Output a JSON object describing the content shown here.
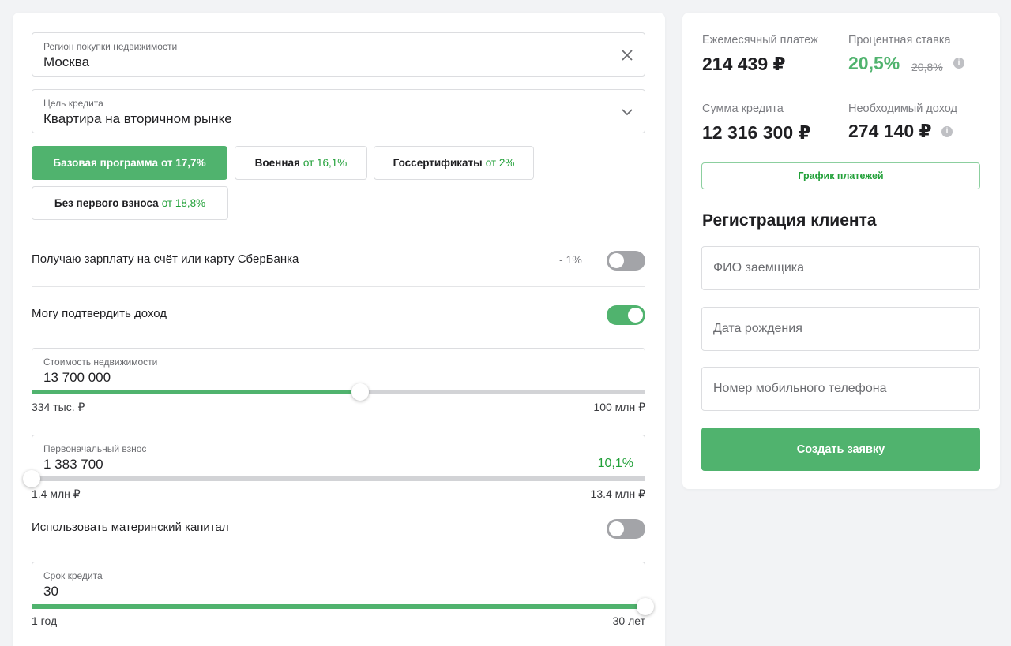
{
  "region": {
    "label": "Регион покупки недвижимости",
    "value": "Москва"
  },
  "purpose": {
    "label": "Цель кредита",
    "value": "Квартира на вторичном рынке"
  },
  "programs": [
    {
      "name": "Базовая программа",
      "rate": "от 17,7%",
      "active": true
    },
    {
      "name": "Военная",
      "rate": "от 16,1%",
      "active": false
    },
    {
      "name": "Госсертификаты",
      "rate": "от 2%",
      "active": false
    },
    {
      "name": "Без первого взноса",
      "rate": "от 18,8%",
      "active": false
    }
  ],
  "salary": {
    "label": "Получаю зарплату на счёт или карту СберБанка",
    "discount": "- 1%",
    "on": false
  },
  "income_confirm": {
    "label": "Могу подтвердить доход",
    "on": true
  },
  "property_cost": {
    "label": "Стоимость недвижимости",
    "value": "13 700 000",
    "min": "334 тыс. ₽",
    "max": "100 млн ₽",
    "fraction": 0.535
  },
  "down_payment": {
    "label": "Первоначальный взнос",
    "value": "1 383 700",
    "percent": "10,1%",
    "min": "1.4 млн ₽",
    "max": "13.4 млн ₽",
    "fraction": 0.0
  },
  "maternity": {
    "label": "Использовать материнский капитал",
    "on": false
  },
  "term": {
    "label": "Срок кредита",
    "value": "30",
    "min": "1 год",
    "max": "30 лет",
    "fraction": 1.0
  },
  "summary": {
    "monthly_label": "Ежемесячный платеж",
    "monthly_value": "214 439 ₽",
    "rate_label": "Процентная ставка",
    "rate_value": "20,5%",
    "rate_old": "20,8%",
    "loan_label": "Сумма кредита",
    "loan_value": "12 316 300 ₽",
    "income_label": "Необходимый доход",
    "income_value": "274 140 ₽",
    "schedule_button": "График платежей"
  },
  "registration": {
    "title": "Регистрация клиента",
    "name_placeholder": "ФИО заемщика",
    "birth_placeholder": "Дата рождения",
    "phone_placeholder": "Номер мобильного телефона",
    "submit": "Создать заявку"
  },
  "colors": {
    "accent": "#50b36e",
    "accent_text": "#21a038",
    "toggle_off": "#a3a4a8"
  },
  "icons": {
    "clear": "close-icon",
    "dropdown": "chevron-down-icon",
    "info": "info-icon"
  }
}
